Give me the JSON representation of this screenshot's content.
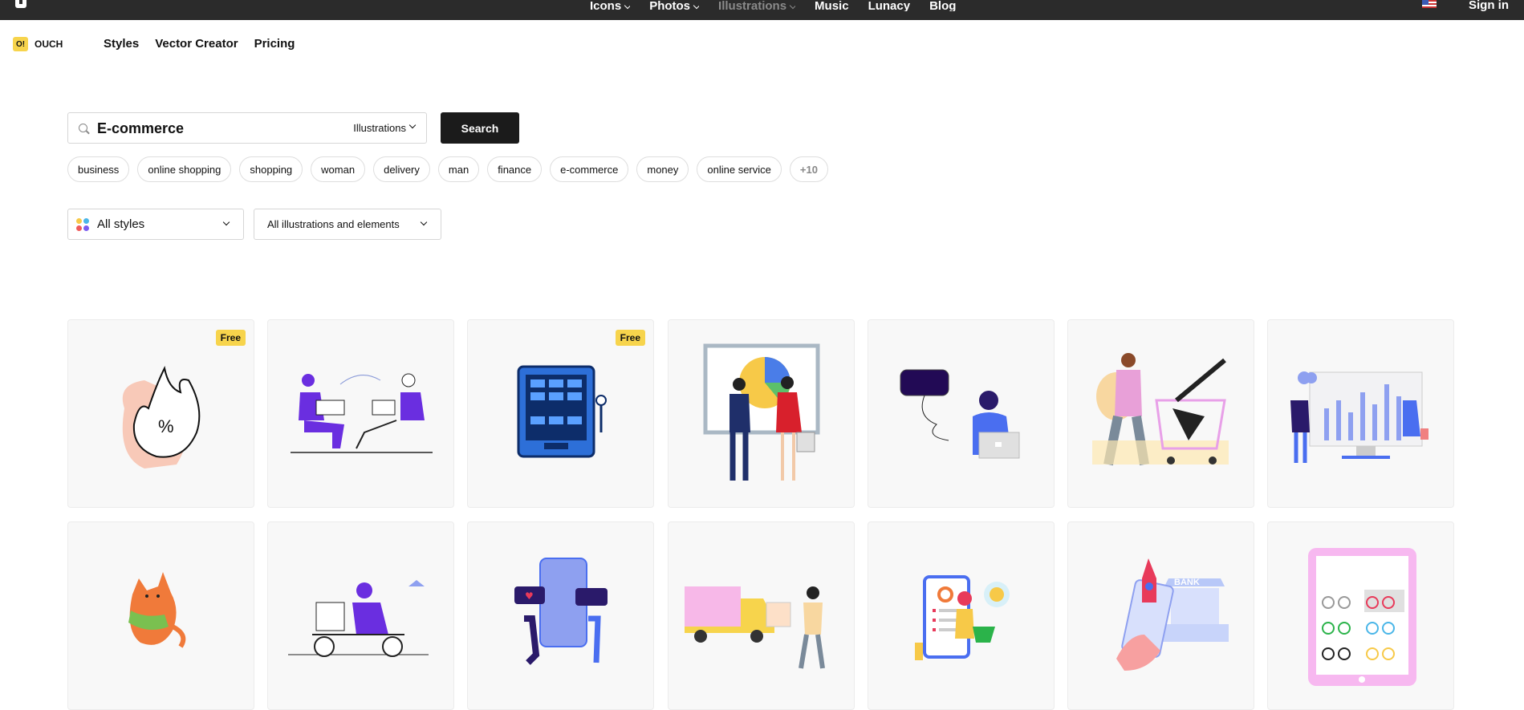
{
  "topbar": {
    "nav": [
      {
        "label": "Icons",
        "dropdown": true,
        "dim": false
      },
      {
        "label": "Photos",
        "dropdown": true,
        "dim": false
      },
      {
        "label": "Illustrations",
        "dropdown": true,
        "dim": true
      },
      {
        "label": "Music",
        "dropdown": false,
        "dim": false
      },
      {
        "label": "Lunacy",
        "dropdown": false,
        "dim": false
      },
      {
        "label": "Blog",
        "dropdown": false,
        "dim": false
      }
    ],
    "sign_in": "Sign in"
  },
  "brand": {
    "badge": "O!",
    "name": "OUCH"
  },
  "subnav": [
    "Styles",
    "Vector Creator",
    "Pricing"
  ],
  "search": {
    "value": "E-commerce",
    "category": "Illustrations",
    "button": "Search"
  },
  "tags": [
    "business",
    "online shopping",
    "shopping",
    "woman",
    "delivery",
    "man",
    "finance",
    "e-commerce",
    "money",
    "online service"
  ],
  "tags_more": "+10",
  "filters": {
    "style": "All styles",
    "type": "All illustrations and elements"
  },
  "free_label": "Free",
  "cards": [
    {
      "name": "card-fire-discount",
      "free": true
    },
    {
      "name": "card-analytics-team",
      "free": false
    },
    {
      "name": "card-vending-machine",
      "free": true
    },
    {
      "name": "card-business-handshake",
      "free": false
    },
    {
      "name": "card-woman-laptop-chat",
      "free": false
    },
    {
      "name": "card-shopping-cart-woman",
      "free": false
    },
    {
      "name": "card-dashboard-chart",
      "free": false
    },
    {
      "name": "card-orange-cat",
      "free": false
    },
    {
      "name": "card-scooter-delivery",
      "free": false
    },
    {
      "name": "card-phone-social",
      "free": false
    },
    {
      "name": "card-delivery-truck",
      "free": false
    },
    {
      "name": "card-mobile-shopping",
      "free": false
    },
    {
      "name": "card-rocket-bank",
      "free": false
    },
    {
      "name": "card-tablet-bicycles",
      "free": false
    }
  ],
  "colors": {
    "accent": "#f7d44c",
    "topbar": "#2b2b2b",
    "button": "#1b1b1b"
  }
}
